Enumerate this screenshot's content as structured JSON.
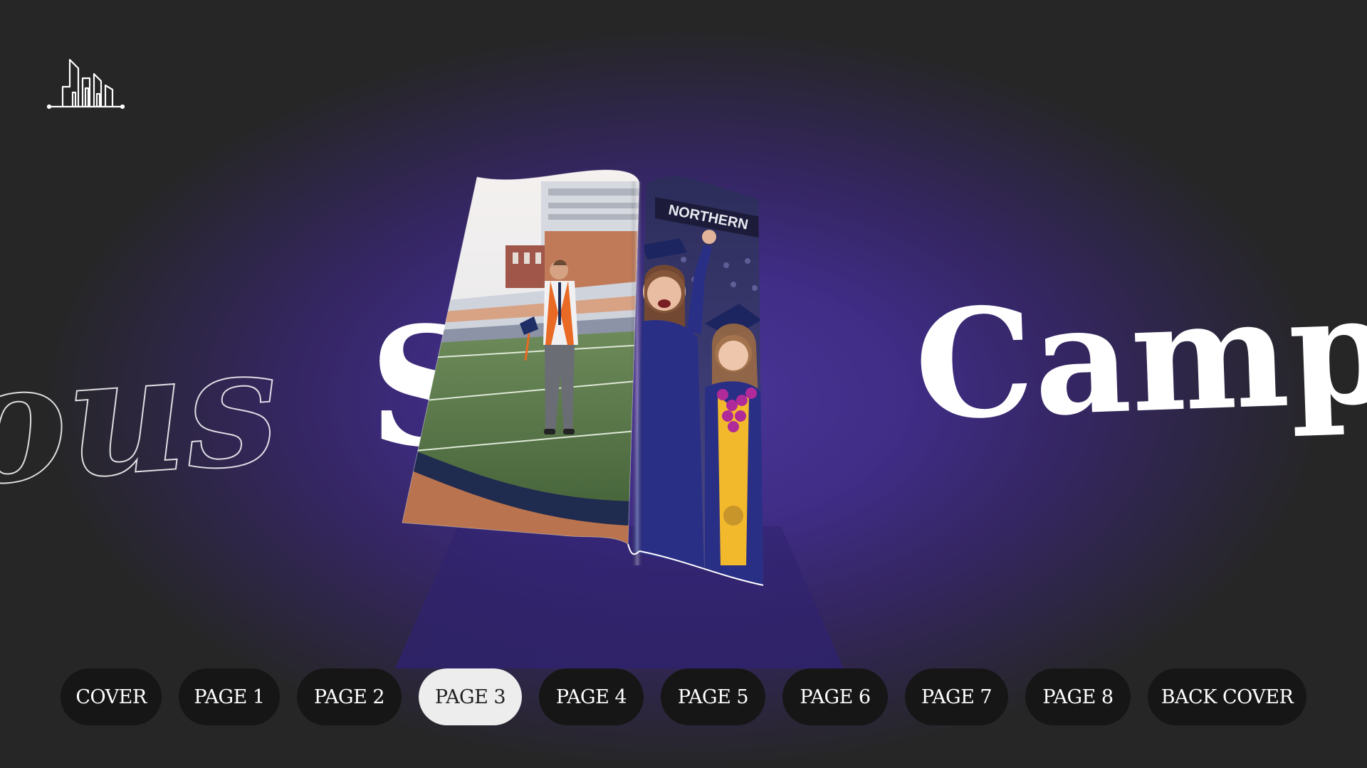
{
  "hero": {
    "word_outline": "ous",
    "word_middle": "S",
    "word_right": "Camp"
  },
  "magazine": {
    "right_page_banner": "NORTHERN"
  },
  "nav": {
    "items": [
      {
        "label": "COVER",
        "active": false
      },
      {
        "label": "PAGE 1",
        "active": false
      },
      {
        "label": "PAGE 2",
        "active": false
      },
      {
        "label": "PAGE 3",
        "active": true
      },
      {
        "label": "PAGE 4",
        "active": false
      },
      {
        "label": "PAGE 5",
        "active": false
      },
      {
        "label": "PAGE 6",
        "active": false
      },
      {
        "label": "PAGE 7",
        "active": false
      },
      {
        "label": "PAGE 8",
        "active": false
      },
      {
        "label": "BACK COVER",
        "active": false
      }
    ]
  },
  "colors": {
    "background": "#262626",
    "accent_purple": "#3f2d86",
    "button_bg": "#161616",
    "button_active_bg": "#ededed"
  }
}
